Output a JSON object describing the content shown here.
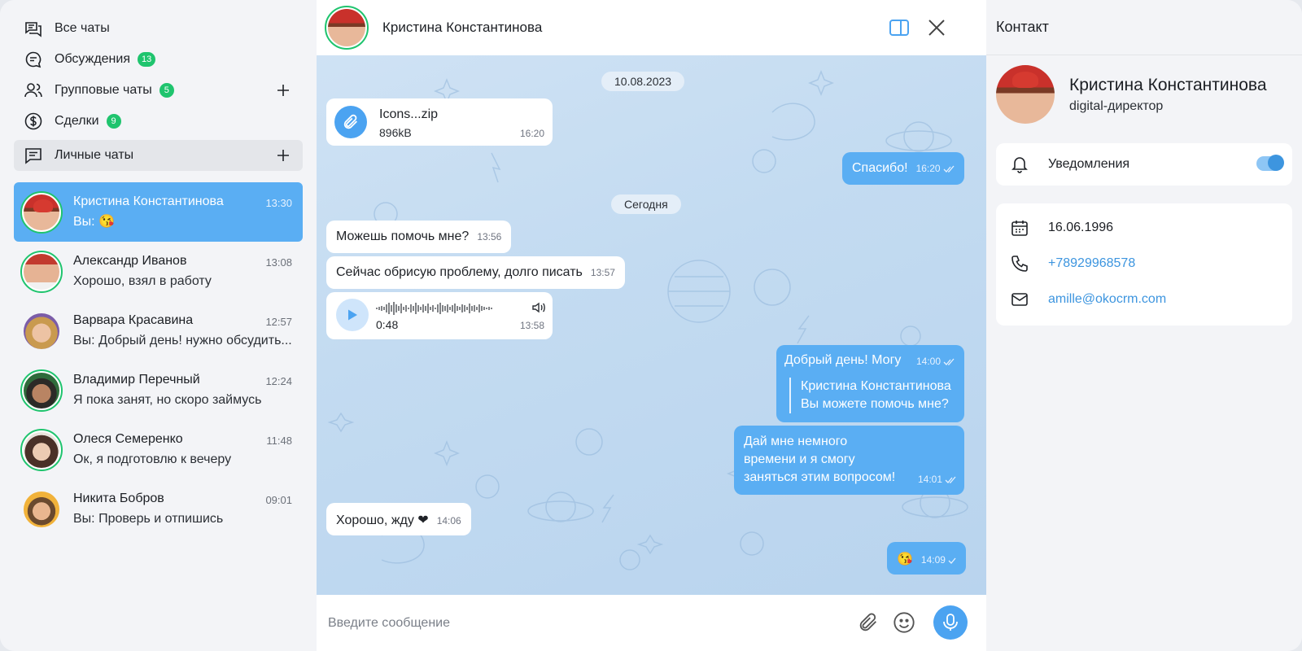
{
  "sidebar": {
    "nav": [
      {
        "label": "Все чаты",
        "icon": "chats-icon"
      },
      {
        "label": "Обсуждения",
        "icon": "discussion-icon",
        "badge": "13"
      },
      {
        "label": "Групповые чаты",
        "icon": "users-icon",
        "badge": "5"
      },
      {
        "label": "Сделки",
        "icon": "dollar-icon",
        "badge": "9"
      },
      {
        "label": "Личные чаты",
        "icon": "personal-chat-icon"
      }
    ],
    "chats": [
      {
        "name": "Кристина Константинова",
        "time": "13:30",
        "last": "Вы: 😘"
      },
      {
        "name": "Александр Иванов",
        "time": "13:08",
        "last": "Хорошо, взял в работу"
      },
      {
        "name": "Варвара Красавина",
        "time": "12:57",
        "last": "Вы: Добрый день! нужно обсудить..."
      },
      {
        "name": "Владимир Перечный",
        "time": "12:24",
        "last": "Я пока занят, но скоро займусь"
      },
      {
        "name": "Олеся Семеренко",
        "time": "11:48",
        "last": "Ок, я подготовлю к вечеру"
      },
      {
        "name": "Никита Бобров",
        "time": "09:01",
        "last": "Вы: Проверь и отпишись"
      }
    ]
  },
  "chat": {
    "title": "Кристина Константинова",
    "dates": {
      "first": "10.08.2023",
      "second": "Сегодня"
    },
    "file": {
      "name": "Icons...zip",
      "size": "896kB",
      "time": "16:20"
    },
    "messages": {
      "thanks": {
        "text": "Спасибо!",
        "time": "16:20"
      },
      "help": {
        "text": "Можешь помочь мне?",
        "time": "13:56"
      },
      "describe": {
        "text": "Сейчас обрисую проблему, долго писать",
        "time": "13:57"
      },
      "voice": {
        "duration": "0:48",
        "time": "13:58"
      },
      "reply": {
        "text": "Добрый день! Могу",
        "time": "14:00",
        "quote_name": "Кристина Константинова",
        "quote_text": "Вы можете помочь мне?"
      },
      "time_msg": {
        "line1": "Дай мне немного",
        "line2": "времени и я смогу",
        "line3": "заняться этим вопросом!",
        "time": "14:01"
      },
      "wait": {
        "text": "Хорошо, жду ❤",
        "time": "14:06"
      },
      "emoji": {
        "text": "😘",
        "time": "14:09"
      }
    },
    "composer_placeholder": "Введите сообщение"
  },
  "contact": {
    "header": "Контакт",
    "name": "Кристина Константинова",
    "role": "digital-директор",
    "notifications_label": "Уведомления",
    "notifications_on": true,
    "birthday": "16.06.1996",
    "phone": "+78929968578",
    "email": "amille@okocrm.com"
  },
  "colors": {
    "accent": "#5aaef3",
    "badge": "#1fc46e",
    "link": "#3d95df"
  }
}
